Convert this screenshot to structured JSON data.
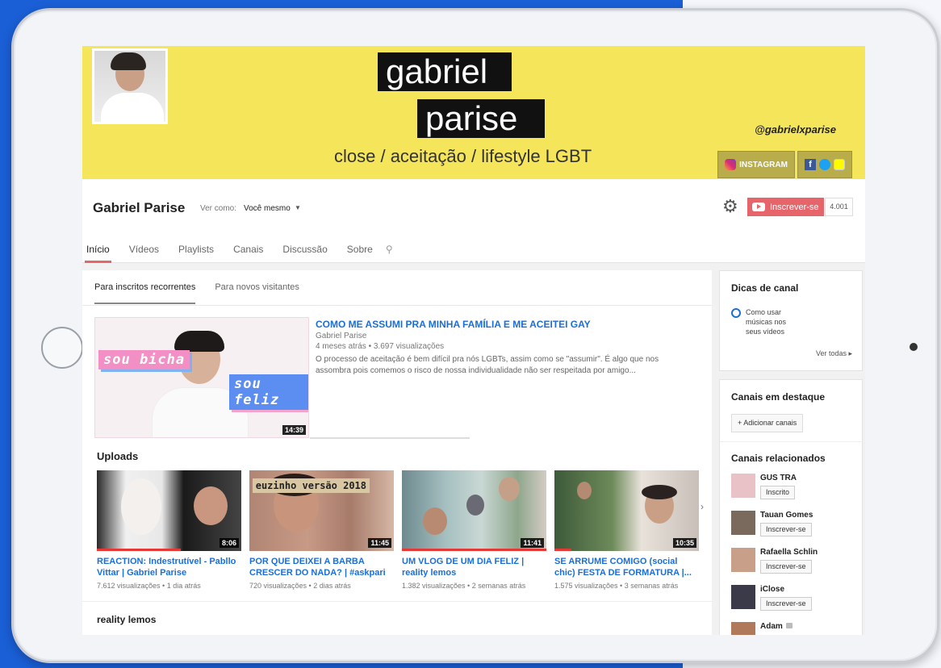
{
  "banner": {
    "title_line1": "gabriel",
    "title_line2": "parise",
    "tagline": "close / aceitação / lifestyle LGBT",
    "handle": "@gabrielxparise",
    "instagram_label": "INSTAGRAM"
  },
  "channel": {
    "name": "Gabriel Parise",
    "view_as_label": "Ver como:",
    "view_as_value": "Você mesmo",
    "subscribe_label": "Inscrever-se",
    "subscriber_count": "4.001",
    "tabs": [
      "Início",
      "Vídeos",
      "Playlists",
      "Canais",
      "Discussão",
      "Sobre"
    ]
  },
  "main": {
    "subtabs": [
      "Para inscritos recorrentes",
      "Para novos visitantes"
    ],
    "featured": {
      "sticker1": "sou bicha",
      "sticker2": "sou feliz",
      "duration": "14:39",
      "title": "COMO ME ASSUMI PRA MINHA FAMÍLIA E ME ACEITEI GAY",
      "author": "Gabriel Parise",
      "meta": "4 meses atrás • 3.697 visualizações",
      "description": "O processo de aceitação é bem difícil pra nós LGBTs, assim como se \"assumir\". É algo que nos assombra pois comemos o risco de nossa individualidade não ser respeitada por amigo..."
    },
    "uploads_title": "Uploads",
    "uploads": [
      {
        "title": "REACTION: Indestrutível - Pabllo Vittar | Gabriel Parise",
        "meta": "7.612 visualizações • 1 dia atrás",
        "duration": "8:06",
        "progress": 0.58
      },
      {
        "title": "POR QUE DEIXEI A BARBA CRESCER DO NADA? | #askpari",
        "meta": "720 visualizações • 2 dias atrás",
        "duration": "11:45",
        "progress": 0,
        "overlay": "euzinho versão 2018"
      },
      {
        "title": "UM VLOG DE UM DIA FELIZ | reality lemos",
        "meta": "1.382 visualizações • 2 semanas atrás",
        "duration": "11:41",
        "progress": 1.0
      },
      {
        "title": "SE ARRUME COMIGO (social chic) FESTA DE FORMATURA |...",
        "meta": "1.575 visualizações • 3 semanas atrás",
        "duration": "10:35",
        "progress": 0.12
      }
    ],
    "next_section": "reality lemos"
  },
  "sidebar": {
    "tips_title": "Dicas de canal",
    "tip_text": "Como usar músicas nos seus vídeos",
    "see_all": "Ver todas",
    "featured_title": "Canais em destaque",
    "add_channels": "+ Adicionar canais",
    "related_title": "Canais relacionados",
    "related": [
      {
        "name": "GUS TRA",
        "button": "Inscrito",
        "color": "#e8c2c6"
      },
      {
        "name": "Tauan Gomes",
        "button": "Inscrever-se",
        "color": "#7a6a5e"
      },
      {
        "name": "Rafaella Schlin",
        "button": "Inscrever-se",
        "color": "#c8a08a"
      },
      {
        "name": "iClose",
        "button": "Inscrever-se",
        "color": "#3a3a48"
      },
      {
        "name": "Adam",
        "button": "",
        "color": "#b07a5a"
      }
    ]
  },
  "colors": {
    "banner_yellow": "#f4e55a",
    "link_blue": "#1a6ed8",
    "subscribe_red": "#e5656b"
  }
}
